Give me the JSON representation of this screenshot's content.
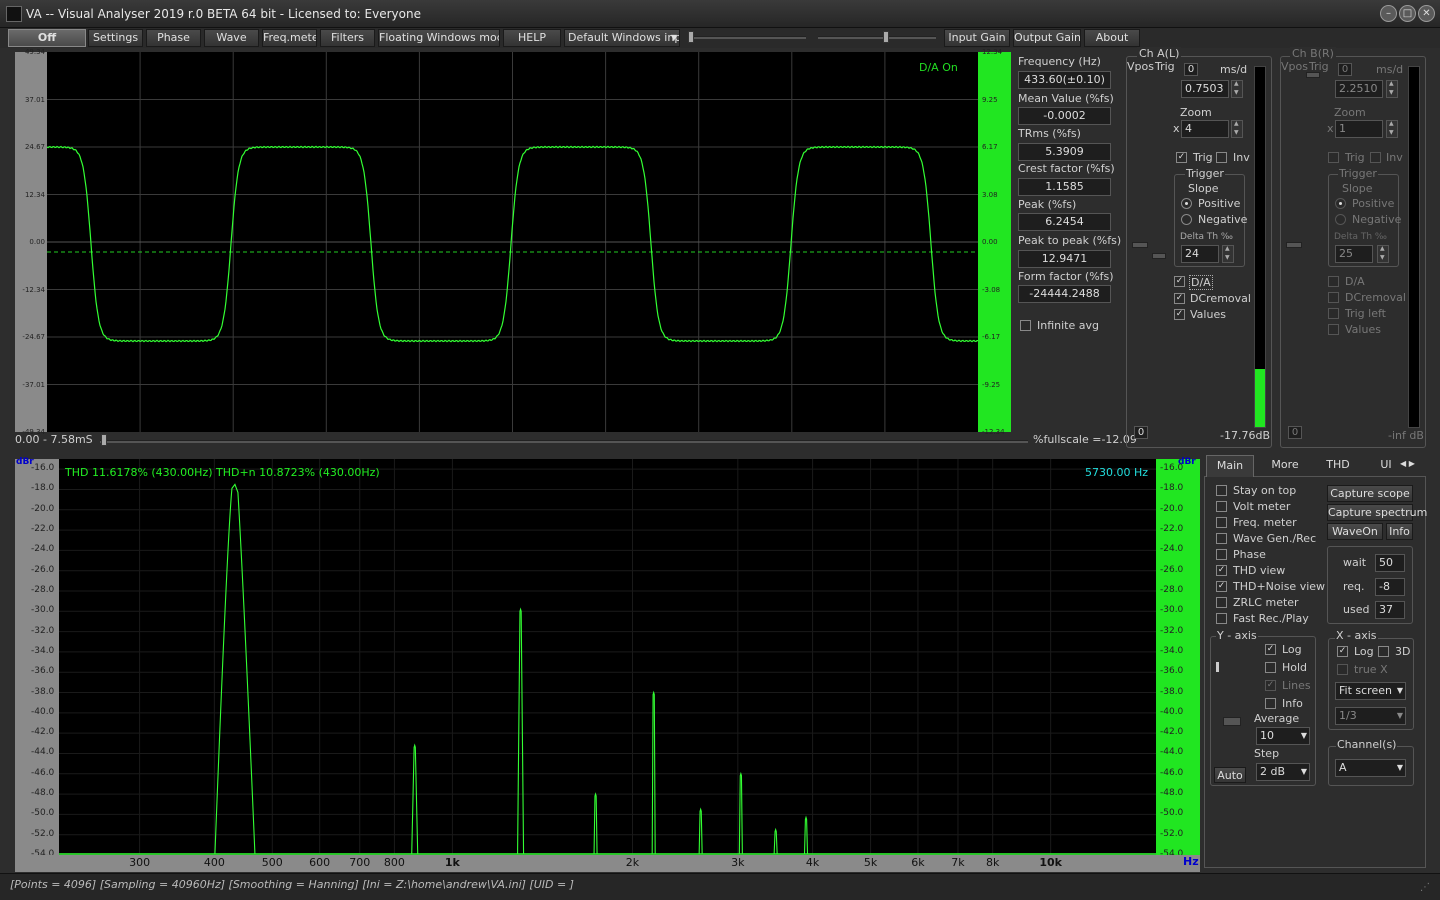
{
  "window": {
    "title": "VA -- Visual Analyser 2019 r.0 BETA 64 bit - Licensed to: Everyone"
  },
  "menu": {
    "off": "Off",
    "settings": "Settings",
    "phase": "Phase",
    "wave": "Wave",
    "freqmeter": "Freq.meter",
    "filters": "Filters",
    "floating": "Floating Windows mode",
    "help": "HELP",
    "display_mode": "Default Windows inp",
    "input_gain": "Input Gain",
    "output_gain": "Output Gain",
    "about": "About"
  },
  "scope": {
    "da_on": "D/A On",
    "left_ticks": [
      "49.34",
      "37.01",
      "24.67",
      "12.34",
      "0.00",
      "-12.34",
      "-24.67",
      "-37.01",
      "-49.34"
    ],
    "right_ticks": [
      "12.34",
      "9.25",
      "6.17",
      "3.08",
      "0.00",
      "-3.08",
      "-6.17",
      "-9.25",
      "-12.34"
    ],
    "time_range": "0.00 - 7.58mS",
    "fullscale": "%fullscale =-12.09",
    "trace_color": "#33ff33"
  },
  "measurements": {
    "frequency_label": "Frequency (Hz)",
    "frequency": "433.60(±0.10)",
    "mean_label": "Mean Value (%fs)",
    "mean": "-0.0002",
    "trms_label": "TRms (%fs)",
    "trms": "5.3909",
    "crest_label": "Crest factor (%fs)",
    "crest": "1.1585",
    "peak_label": "Peak (%fs)",
    "peak": "6.2454",
    "p2p_label": "Peak to peak (%fs)",
    "p2p": "12.9471",
    "form_label": "Form factor (%fs)",
    "form": "-24444.2488",
    "infinite_avg": "Infinite avg"
  },
  "channel_a": {
    "title": "Ch A(L)",
    "vpos": "Vpos",
    "trig": "Trig",
    "zero": "0",
    "ms_div": "ms/d",
    "ms_value": "0.7503",
    "zoom_label": "Zoom",
    "x": "x",
    "zoom_value": "4",
    "trig_cb": "Trig",
    "inv_cb": "Inv",
    "trigger_label": "Trigger",
    "slope_label": "Slope",
    "positive": "Positive",
    "negative": "Negative",
    "delta_label": "Delta Th ‰",
    "delta_value": "24",
    "da": "D/A",
    "dcremoval": "DCremoval",
    "values": "Values",
    "level": "-17.76dB",
    "meter_fill": 0.16
  },
  "channel_b": {
    "title": "Ch B(R)",
    "vpos": "Vpos",
    "trig": "Trig",
    "zero": "0",
    "ms_div": "ms/d",
    "ms_value": "2.2510",
    "zoom_label": "Zoom",
    "x": "x",
    "zoom_value": "1",
    "trig_cb": "Trig",
    "inv_cb": "Inv",
    "trigger_label": "Trigger",
    "slope_label": "Slope",
    "positive": "Positive",
    "negative": "Negative",
    "delta_label": "Delta Th ‰",
    "delta_value": "25",
    "da": "D/A",
    "dcremoval": "DCremoval",
    "trig_left": "Trig left",
    "values": "Values",
    "level": "-inf dB"
  },
  "spectrum": {
    "unit": "dBr",
    "thd_text": "THD 11.6178% (430.00Hz) THD+n 10.8723% (430.00Hz)",
    "cursor_freq": "5730.00 Hz",
    "y_ticks": [
      "-16.0",
      "-18.0",
      "-20.0",
      "-22.0",
      "-24.0",
      "-26.0",
      "-28.0",
      "-30.0",
      "-32.0",
      "-34.0",
      "-36.0",
      "-38.0",
      "-40.0",
      "-42.0",
      "-44.0",
      "-46.0",
      "-48.0",
      "-50.0",
      "-52.0",
      "-54.0"
    ],
    "x_ticks": [
      {
        "label": "300",
        "f": 300
      },
      {
        "label": "400",
        "f": 400
      },
      {
        "label": "500",
        "f": 500
      },
      {
        "label": "600",
        "f": 600
      },
      {
        "label": "700",
        "f": 700
      },
      {
        "label": "800",
        "f": 800
      },
      {
        "label": "1k",
        "f": 1000,
        "bold": true
      },
      {
        "label": "2k",
        "f": 2000
      },
      {
        "label": "3k",
        "f": 3000
      },
      {
        "label": "4k",
        "f": 4000
      },
      {
        "label": "5k",
        "f": 5000
      },
      {
        "label": "6k",
        "f": 6000
      },
      {
        "label": "7k",
        "f": 7000
      },
      {
        "label": "8k",
        "f": 8000
      },
      {
        "label": "10k",
        "f": 10000,
        "bold": true
      }
    ],
    "hz": "Hz"
  },
  "chart_data": {
    "type": "line",
    "x_scale": "log",
    "xlim": [
      220,
      15000
    ],
    "ylim": [
      -54,
      -15
    ],
    "peaks": [
      {
        "f": 433,
        "db": -17.5
      },
      {
        "f": 865,
        "db": -43.2
      },
      {
        "f": 1300,
        "db": -29.8
      },
      {
        "f": 1735,
        "db": -48.0
      },
      {
        "f": 2170,
        "db": -38.0
      },
      {
        "f": 2600,
        "db": -49.5
      },
      {
        "f": 3035,
        "db": -46.0
      },
      {
        "f": 3470,
        "db": -51.5
      },
      {
        "f": 3900,
        "db": -50.3
      }
    ]
  },
  "panel": {
    "tabs": [
      "Main",
      "More",
      "THD",
      "UI"
    ],
    "checks": [
      {
        "label": "Stay on top",
        "checked": false
      },
      {
        "label": "Volt meter",
        "checked": false
      },
      {
        "label": "Freq. meter",
        "checked": false
      },
      {
        "label": "Wave Gen./Rec",
        "checked": false
      },
      {
        "label": "Phase",
        "checked": false
      },
      {
        "label": "THD view",
        "checked": true
      },
      {
        "label": "THD+Noise view",
        "checked": true
      },
      {
        "label": "ZRLC meter",
        "checked": false
      },
      {
        "label": "Fast Rec./Play",
        "checked": false
      }
    ],
    "capture_scope": "Capture scope",
    "capture_spectrum": "Capture spectrum",
    "waveon": "WaveOn",
    "info": "Info",
    "wait_label": "wait",
    "wait": "50",
    "req_label": "req.",
    "req": "-8",
    "used_label": "used",
    "used": "37",
    "yaxis": "Y - axis",
    "log": "Log",
    "hold": "Hold",
    "lines": "Lines",
    "info_cb": "Info",
    "average_label": "Average",
    "average": "10",
    "step_label": "Step",
    "step": "2 dB",
    "auto": "Auto",
    "xaxis": "X - axis",
    "xlog": "Log",
    "x3d": "3D",
    "truex": "true X",
    "fit": "Fit screen",
    "octave": "1/3",
    "channels_label": "Channel(s)",
    "channel": "A"
  },
  "status": "[Points = 4096]  [Sampling = 40960Hz]  [Smoothing = Hanning]  [Ini = Z:\\home\\andrew\\VA.ini]  [UID = ]"
}
